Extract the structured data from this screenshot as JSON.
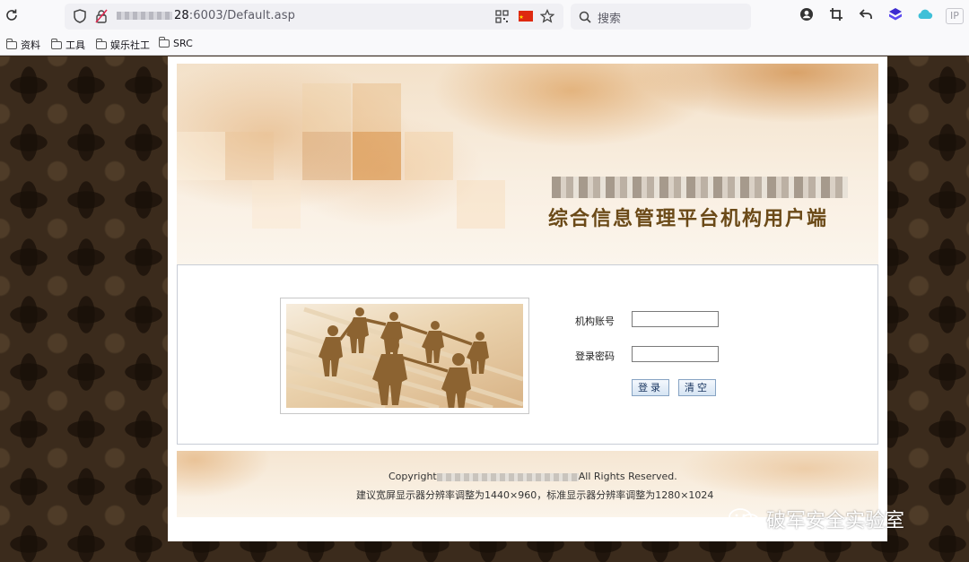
{
  "browser": {
    "url_prefix": "28",
    "url_suffix": ":6003/Default.asp",
    "search_placeholder": "搜索",
    "ip_badge": "IP",
    "bookmarks": [
      "资料",
      "工具",
      "娱乐社工",
      "SRC"
    ]
  },
  "page": {
    "header_title": "综合信息管理平台机构用户端",
    "login": {
      "account_label": "机构账号",
      "account_value": "",
      "password_label": "登录密码",
      "password_value": "",
      "login_button": "登录",
      "clear_button": "清空"
    },
    "footer": {
      "copyright_prefix": "Copyright",
      "copyright_suffix": "All Rights Reserved.",
      "resolution_note": "建议宽屏显示器分辨率调整为1440×960，标准显示器分辨率调整为1280×1024"
    }
  },
  "watermark": {
    "text": "破军安全实验室"
  },
  "colors": {
    "title_brown": "#6b4a18",
    "page_background": "#3b2b1c",
    "button_text": "#1a3660"
  }
}
